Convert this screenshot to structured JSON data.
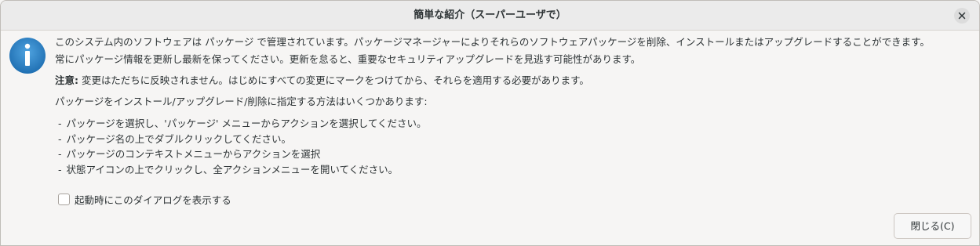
{
  "window": {
    "title": "簡単な紹介（スーパーユーザで）"
  },
  "icons": {
    "info": "info-icon",
    "close": "close-icon"
  },
  "content": {
    "p1": "このシステム内のソフトウェアは パッケージ で管理されています。パッケージマネージャーによりそれらのソフトウェアパッケージを削除、インストールまたはアップグレードすることができます。",
    "p2": "常にパッケージ情報を更新し最新を保ってください。更新を怠ると、重要なセキュリティアップグレードを見逃す可能性があります。",
    "p3_bold": "注意:",
    "p3_rest": " 変更はただちに反映されません。はじめにすべての変更にマークをつけてから、それらを適用する必要があります。",
    "p4": "パッケージをインストール/アップグレード/削除に指定する方法はいくつかあります:",
    "methods": [
      "パッケージを選択し、'パッケージ' メニューからアクションを選択してください。",
      "パッケージ名の上でダブルクリックしてください。",
      "パッケージのコンテキストメニューからアクションを選択",
      "状態アイコンの上でクリックし、全アクションメニューを開いてください。"
    ],
    "bullet": "-"
  },
  "checkbox": {
    "label": "起動時にこのダイアログを表示する",
    "checked": false
  },
  "buttons": {
    "close_label": "閉じる(C)"
  },
  "colors": {
    "info_icon": "#2f86c8",
    "titlebar": "#ebebeb",
    "background": "#f6f5f4"
  }
}
